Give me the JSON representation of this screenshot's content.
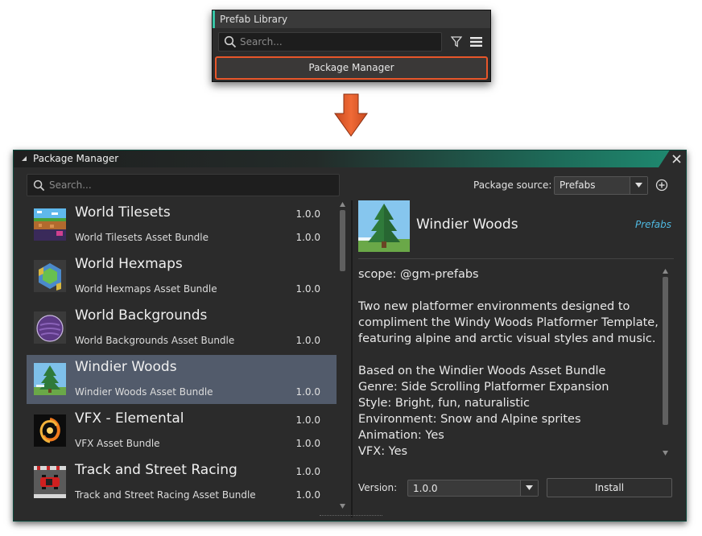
{
  "prefab_library": {
    "title": "Prefab Library",
    "search_placeholder": "Search...",
    "package_manager_button": "Package Manager",
    "highlight_color": "#e8562a"
  },
  "arrow_color": "#e0572a",
  "package_manager": {
    "title": "Package Manager",
    "search_placeholder": "Search...",
    "package_source_label": "Package source:",
    "package_source_value": "Prefabs",
    "packages": [
      {
        "name": "World Tilesets",
        "version": "1.0.0",
        "bundle": "World Tilesets Asset Bundle",
        "bundle_version": "1.0.0",
        "thumb_icon": "tileset-thumbnail-icon"
      },
      {
        "name": "World Hexmaps",
        "version": "",
        "bundle": "World Hexmaps Asset Bundle",
        "bundle_version": "1.0.0",
        "thumb_icon": "hexmap-thumbnail-icon"
      },
      {
        "name": "World Backgrounds",
        "version": "",
        "bundle": "World Backgrounds Asset Bundle",
        "bundle_version": "1.0.0",
        "thumb_icon": "background-thumbnail-icon"
      },
      {
        "name": "Windier Woods",
        "version": "",
        "bundle": "Windier Woods Asset Bundle",
        "bundle_version": "1.0.0",
        "thumb_icon": "pine-tree-thumbnail-icon",
        "selected": true
      },
      {
        "name": "VFX - Elemental",
        "version": "1.0.0",
        "bundle": "VFX Asset Bundle",
        "bundle_version": "1.0.0",
        "thumb_icon": "fire-vfx-thumbnail-icon"
      },
      {
        "name": "Track and Street Racing",
        "version": "1.0.0",
        "bundle": "Track and Street Racing Asset Bundle",
        "bundle_version": "1.0.0",
        "thumb_icon": "race-car-thumbnail-icon"
      }
    ],
    "detail": {
      "name": "Windier Woods",
      "source": "Prefabs",
      "description": "scope: @gm-prefabs\n\nTwo new platformer environments designed to\ncompliment the Windy Woods Platformer Template,\nfeaturing alpine and arctic visual styles and music.\n\nBased on the Windier Woods Asset Bundle\nGenre: Side Scrolling Platformer Expansion\nStyle: Bright, fun, naturalistic\nEnvironment: Snow and Alpine sprites\nAnimation: Yes\nVFX: Yes",
      "version_label": "Version:",
      "version_value": "1.0.0",
      "install_label": "Install"
    },
    "selected_row_color": "#525b6b",
    "source_link_color": "#4fb8e0"
  }
}
